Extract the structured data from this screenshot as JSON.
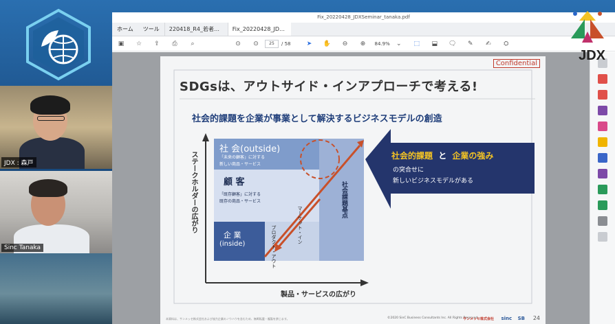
{
  "video": {
    "participants": [
      {
        "name": "JDX : 森戸"
      },
      {
        "name": "Sinc Tanaka"
      }
    ]
  },
  "app": {
    "window_title": "Fix_20220428_JDXSeminar_tanaka.pdf",
    "menu": [
      "ホーム",
      "ツール"
    ],
    "tabs": [
      {
        "label": "220418_R4_若者…",
        "close": "×"
      },
      {
        "label": "Fix_20220428_JD…",
        "close": "×"
      }
    ],
    "toolbar": {
      "page_current": "25",
      "page_total": "/ 58",
      "zoom": "84.9%"
    }
  },
  "slide": {
    "confidential": "Confidential",
    "title": "SDGsは、アウトサイド・インアプローチで考える!",
    "subtitle": "社会的課題を企業が事業として解決するビジネスモデルの創造",
    "y_axis": "ステークホルダーの広がり",
    "x_axis": "製品・サービスの広がり",
    "outside_label": "社 会(outside)",
    "outside_desc_1": "「未来の顧客」に対する",
    "outside_desc_2": "新しい商品・サービス",
    "customer_label": "顧 客",
    "customer_desc_1": "「既存顧客」に対する",
    "customer_desc_2": "既存の商品・サービス",
    "inside_label_1": "企 業",
    "inside_label_2": "(inside)",
    "product_out": "プロダクト・アウト",
    "market_in": "マーケット・イン",
    "social_base": "社会課題基点",
    "arrow_line1_a": "社会的課題",
    "arrow_line1_and": "と",
    "arrow_line1_b": "企業の強み",
    "arrow_line2": "の突合せに",
    "arrow_line3": "新しいビジネスモデルがある",
    "footer_note": "本資料は、サンメッセ株式会社および協力企業のノウハウを含むため、無断転載・複製を禁じます。",
    "footer_copy": "©2020 SinC Business Consultants Inc. All Rights Reserved.",
    "logo_sunmesse": "サンメッセ株式会社",
    "logo_sinc": "sinc",
    "logo_sb": "SB",
    "page_number": "24"
  },
  "jdx": {
    "label": "JDX"
  },
  "colors": {
    "navy": "#24356c",
    "steel": "#6f8fbe",
    "light": "#c7d3e8",
    "red": "#c8502a",
    "yellow": "#f3c324"
  }
}
